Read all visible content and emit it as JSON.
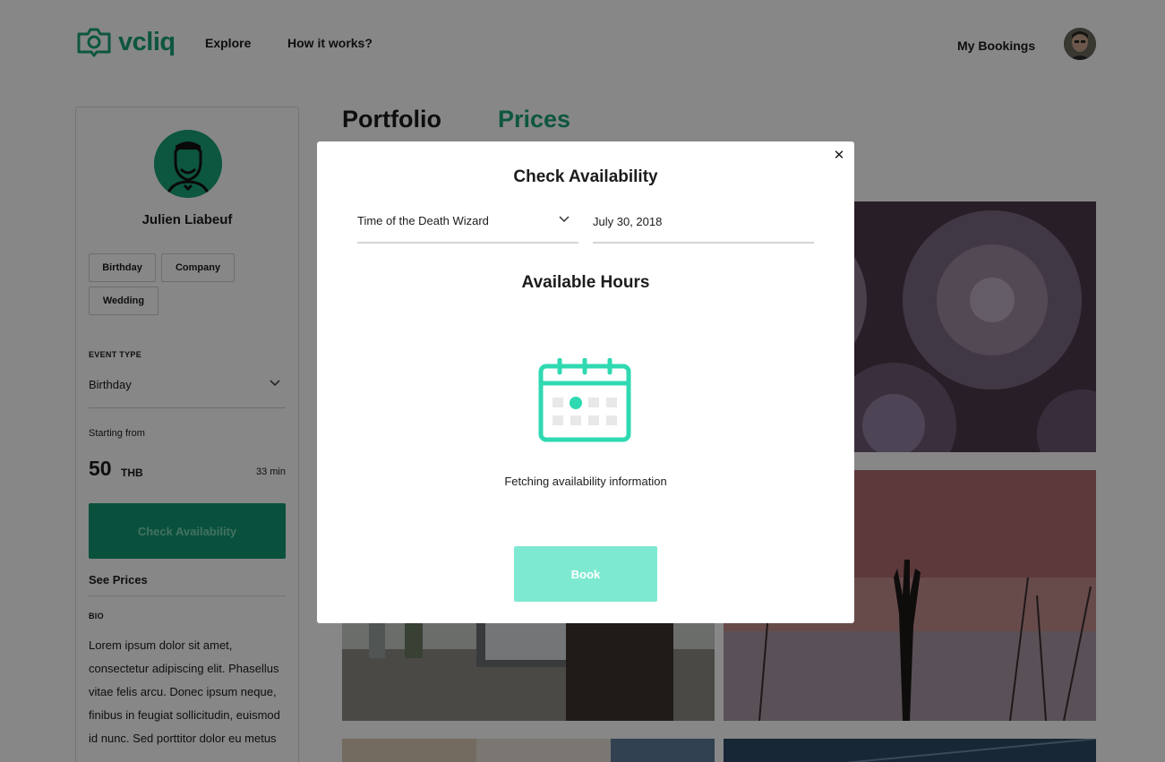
{
  "header": {
    "logo_text": "vcliq",
    "nav": [
      "Explore",
      "How it works?"
    ],
    "my_bookings": "My Bookings"
  },
  "profile": {
    "name": "Julien Liabeuf",
    "tags": [
      "Birthday",
      "Company",
      "Wedding"
    ],
    "event_type_label": "EVENT TYPE",
    "event_type_value": "Birthday",
    "starting_from": "Starting from",
    "price": "50",
    "currency": "THB",
    "duration": "33 min",
    "check_availability": "Check Availability",
    "see_prices": "See Prices",
    "bio_label": "BIO",
    "bio": "Lorem ipsum dolor sit amet, consectetur adipiscing elit. Phasellus vitae felis arcu. Donec ipsum neque, finibus in feugiat sollicitudin, euismod id nunc. Sed porttitor dolor eu metus"
  },
  "main": {
    "tabs": [
      "Portfolio",
      "Prices"
    ],
    "active_tab": "Prices"
  },
  "modal": {
    "title": "Check Availability",
    "close_icon": "close-icon",
    "service_select": "Time of the Death Wizard",
    "date": "July 30, 2018",
    "hours_title": "Available Hours",
    "status": "Fetching availability information",
    "book_button": "Book"
  },
  "colors": {
    "brand": "#1aa37a",
    "button_primary": "#129a74",
    "button_disabled": "#7ee9d1",
    "calendar_icon": "#2fd9b1"
  }
}
